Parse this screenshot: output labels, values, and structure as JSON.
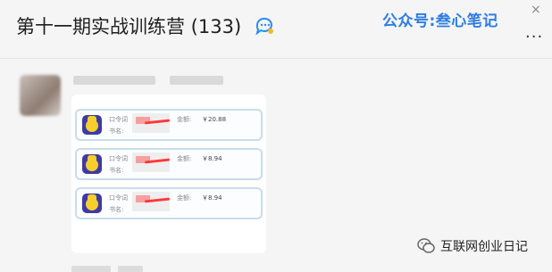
{
  "header": {
    "title": "第十一期实战训练营 (133)",
    "watermark": "公众号:叁心笔记",
    "more_label": "...",
    "close_label": "×"
  },
  "message": {
    "cards": [
      {
        "code_label": "口令词",
        "book_label": "书名:",
        "amount_label": "金额:",
        "amount": "￥20.88"
      },
      {
        "code_label": "口令词",
        "book_label": "书名:",
        "amount_label": "金额:",
        "amount": "￥8.94"
      },
      {
        "code_label": "口令词",
        "book_label": "书名:",
        "amount_label": "金额:",
        "amount": "￥8.94"
      }
    ]
  },
  "footer": {
    "brand": "互联网创业日记"
  }
}
